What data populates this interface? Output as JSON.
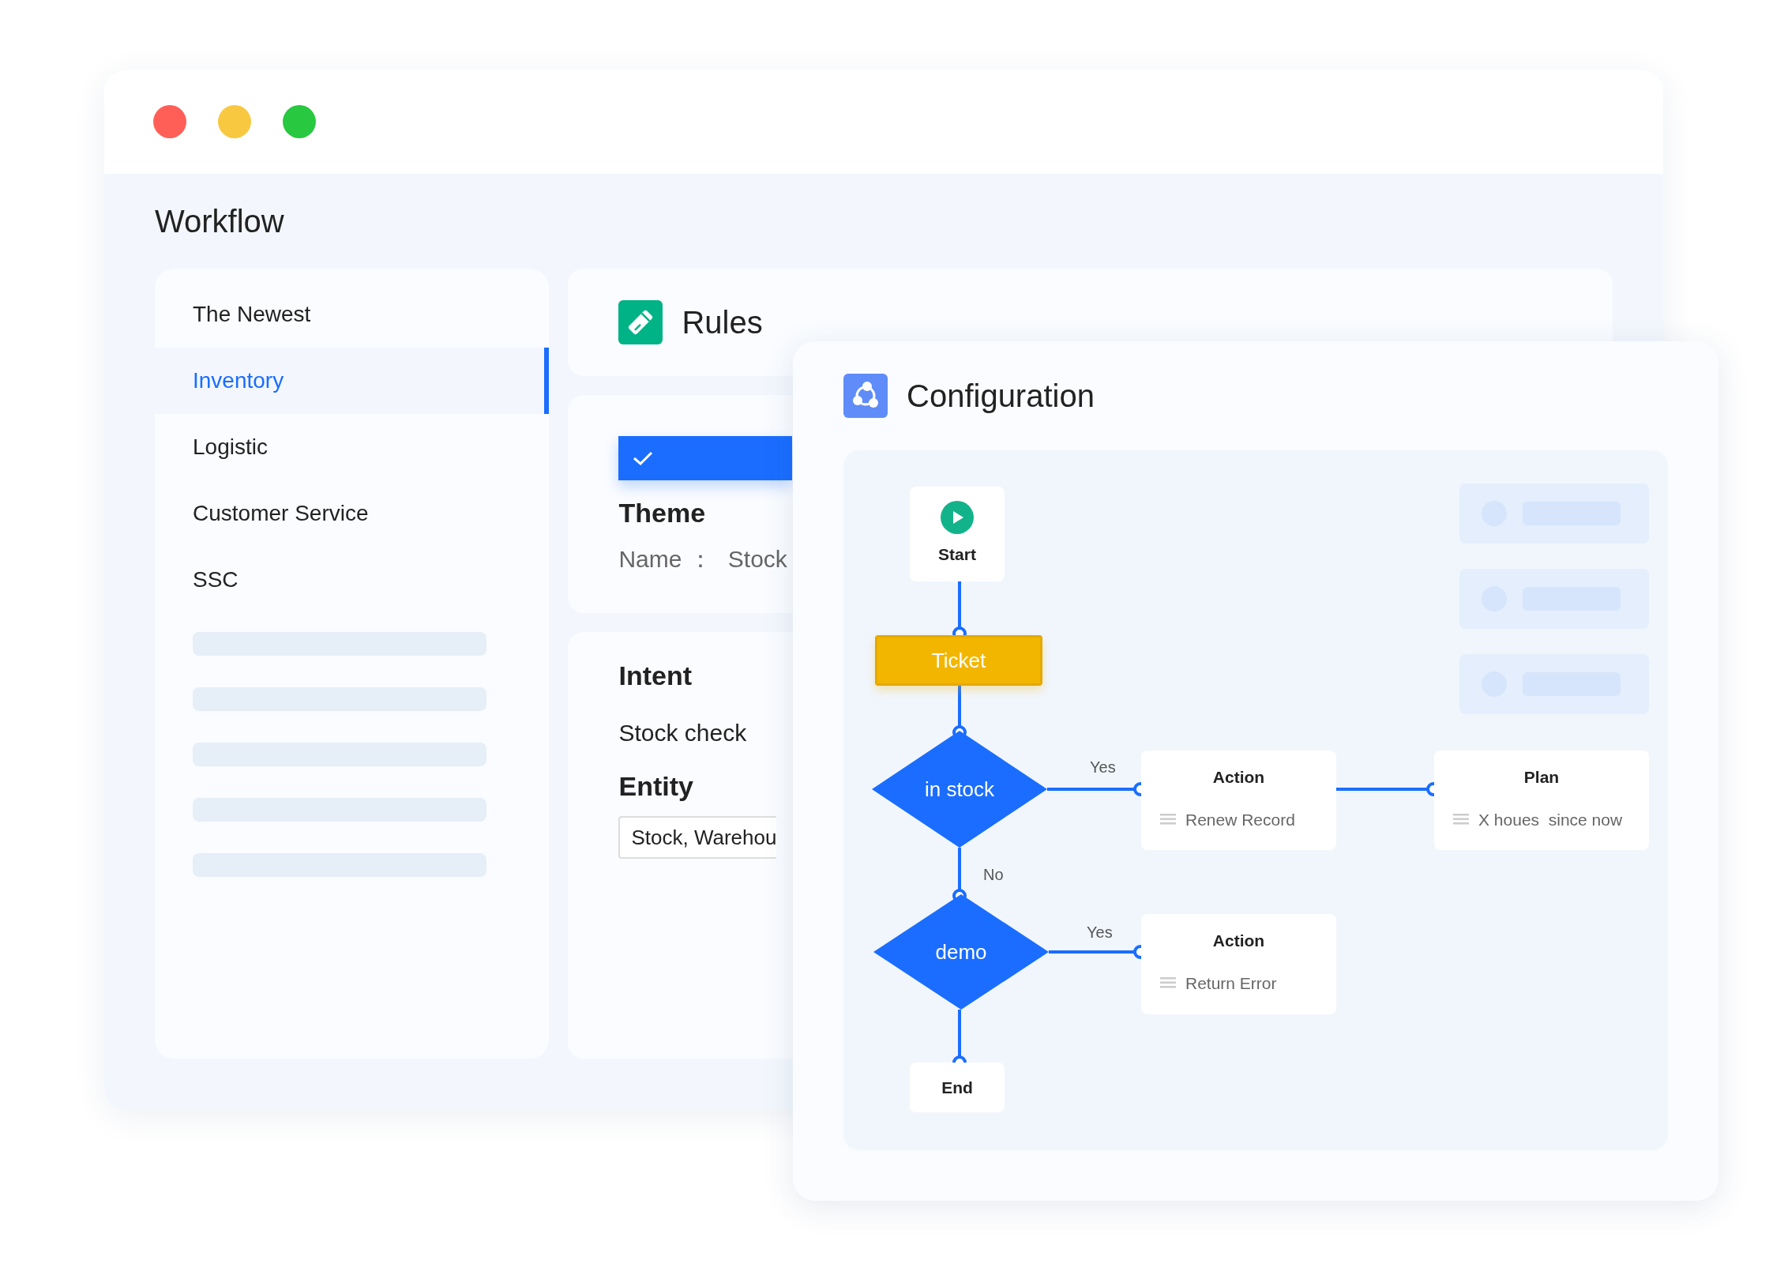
{
  "window": {
    "controls": [
      {
        "color": "#ff5f57"
      },
      {
        "color": "#f8c840"
      },
      {
        "color": "#28c840"
      }
    ]
  },
  "page_title": "Workflow",
  "sidebar": {
    "items": [
      {
        "label": "The Newest",
        "selected": false
      },
      {
        "label": "Inventory",
        "selected": true
      },
      {
        "label": "Logistic",
        "selected": false
      },
      {
        "label": "Customer Service",
        "selected": false
      },
      {
        "label": "SSC",
        "selected": false
      }
    ]
  },
  "rules": {
    "title": "Rules"
  },
  "theme": {
    "checked": true,
    "title": "Theme",
    "name_label": "Name ：",
    "name_value": "Stock"
  },
  "intent": {
    "title": "Intent",
    "value": "Stock check",
    "entity_title": "Entity",
    "entity_value": "Stock, Warehou"
  },
  "configuration": {
    "title": "Configuration",
    "nodes": [
      {
        "kind": "start",
        "label": "Start"
      },
      {
        "kind": "task",
        "label": "Ticket"
      },
      {
        "kind": "decision",
        "label": "in stock"
      },
      {
        "kind": "action",
        "title": "Action",
        "detail": "Renew Record"
      },
      {
        "kind": "action",
        "title": "Plan",
        "detail": "X houes  since now"
      },
      {
        "kind": "decision",
        "label": "demo"
      },
      {
        "kind": "action",
        "title": "Action",
        "detail": "Return Error"
      },
      {
        "kind": "end",
        "label": "End"
      }
    ],
    "edge_labels": [
      "Yes",
      "No",
      "Yes"
    ]
  }
}
